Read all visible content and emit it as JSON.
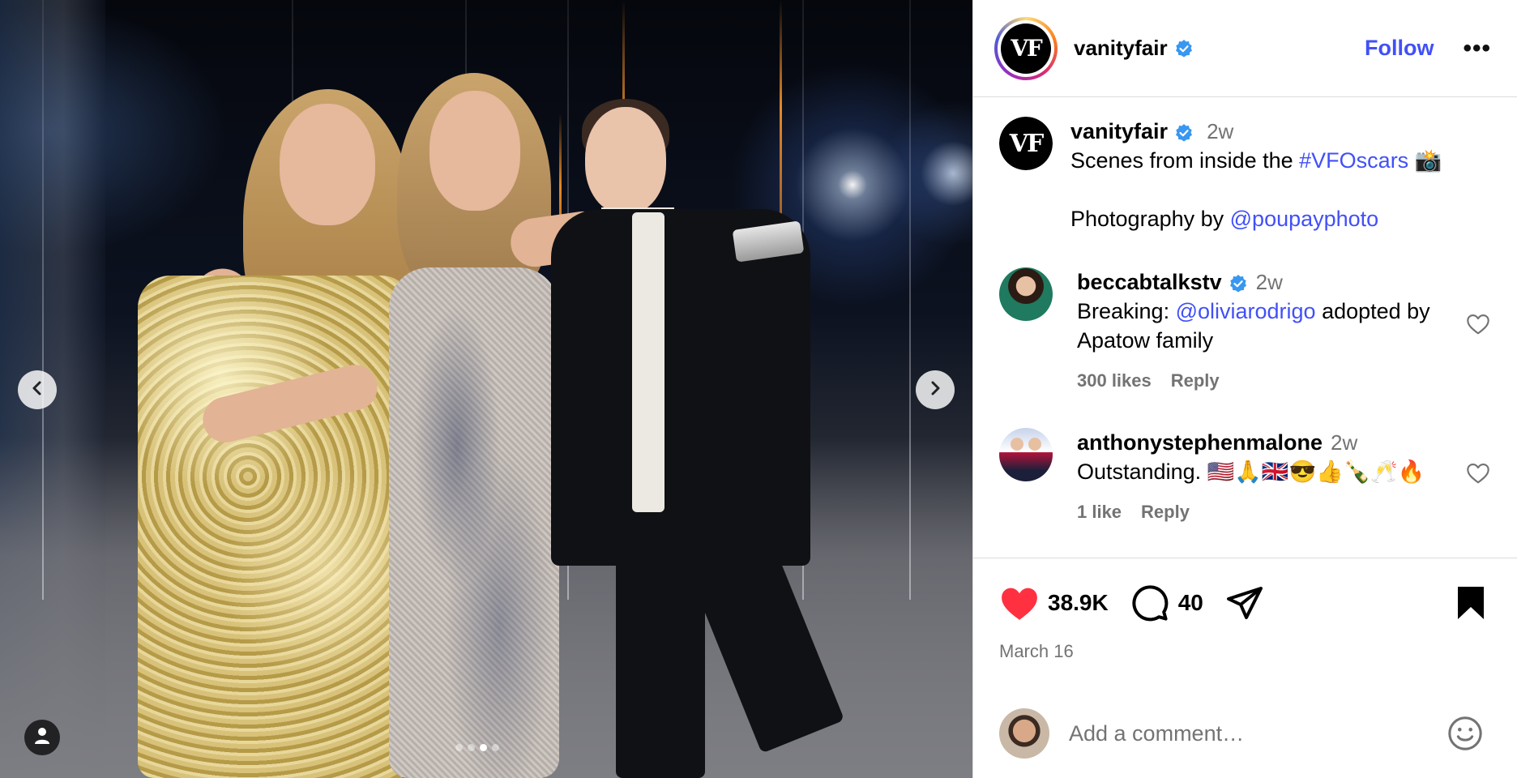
{
  "post": {
    "author": "vanityfair",
    "follow_label": "Follow",
    "more_label": "•••",
    "avatar_text": "VF"
  },
  "caption": {
    "author": "vanityfair",
    "time": "2w",
    "text_prefix": "Scenes from inside the ",
    "hashtag": "#VFOscars",
    "emoji": "📸",
    "credit_prefix": "Photography by ",
    "credit_mention": "@poupayphoto"
  },
  "comments": [
    {
      "username": "beccabtalkstv",
      "verified": true,
      "time": "2w",
      "text_prefix": "Breaking: ",
      "mention": "@oliviarodrigo",
      "text_suffix": " adopted by Apatow family",
      "likes": "300 likes",
      "reply_label": "Reply"
    },
    {
      "username": "anthonystephenmalone",
      "verified": false,
      "time": "2w",
      "text": "Outstanding. 🇺🇸🙏🇬🇧😎👍🍾🥂🔥",
      "likes": "1 like",
      "reply_label": "Reply"
    }
  ],
  "actions": {
    "likes_count": "38.9K",
    "comments_count": "40",
    "date": "March 16"
  },
  "add_comment": {
    "placeholder": "Add a comment…"
  },
  "carousel": {
    "total": 4,
    "active_index": 2
  },
  "colors": {
    "link": "#4150f7",
    "like_red": "#ff3040",
    "verified_blue": "#3897f0",
    "muted": "#737373"
  }
}
